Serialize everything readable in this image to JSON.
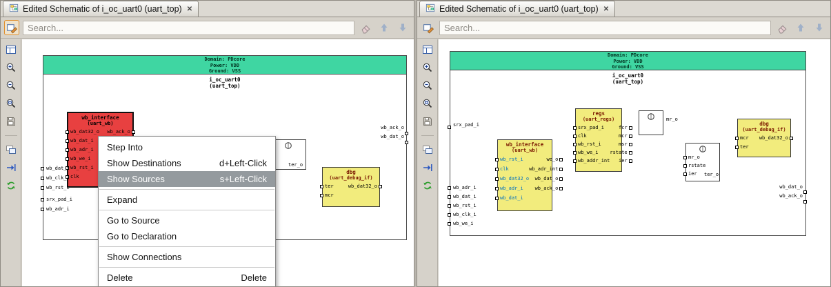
{
  "colors": {
    "domain_band": "#3fd6a2",
    "selected_block": "#e84040",
    "module_block": "#f2ec7d",
    "menu_highlight": "#949a9e",
    "blue_port": "#0070c0"
  },
  "sidebar_icons": [
    "view-grid",
    "zoom-in",
    "zoom-out",
    "zoom-fit",
    "save",
    "new-window",
    "trace-arrows",
    "reload"
  ],
  "panels": [
    {
      "tab": {
        "title": "Edited Schematic of i_oc_uart0 (uart_top)",
        "close_glyph": "✕"
      },
      "toolbar": {
        "search_placeholder": "Search..."
      },
      "schematic": {
        "domain_lines": [
          "Domain: PDcore",
          "Power: VDD",
          "Ground: VSS"
        ],
        "instance_name": "i_oc_uart0",
        "instance_type": "(uart_top)",
        "edge_pins_left": [
          "wb_dat_i",
          "wb_clk_i",
          "wb_rst_i"
        ],
        "edge_pins_left2": [
          "srx_pad_i",
          "wb_adr_i"
        ],
        "edge_labels_right": [
          "wb_ack_o",
          "wb_dat_o"
        ],
        "blocks": {
          "wb": {
            "title": "wb_interface",
            "subtitle": "(uart_wb)",
            "ports_left": [
              "wb_dat32_o",
              "wb_dat_i",
              "wb_adr_i",
              "wb_we_i",
              "wb_rst_i",
              "clk"
            ],
            "ports_right": [
              "wb_ack_o"
            ]
          },
          "gate": {
            "label": "ter_o"
          },
          "dbg": {
            "title": "dbg",
            "subtitle": "(uart_debug_if)",
            "ports_left": [
              "ter",
              "mcr"
            ],
            "ports_right": [
              "wb_dat32_o"
            ]
          }
        }
      },
      "context_menu": {
        "items": [
          {
            "label": "Step Into",
            "shortcut": ""
          },
          {
            "label": "Show Destinations",
            "shortcut": "d+Left-Click"
          },
          {
            "label": "Show Sources",
            "shortcut": "s+Left-Click"
          },
          {
            "label": "Expand",
            "shortcut": ""
          },
          {
            "label": "Go to Source",
            "shortcut": ""
          },
          {
            "label": "Go to Declaration",
            "shortcut": ""
          },
          {
            "label": "Show Connections",
            "shortcut": ""
          },
          {
            "label": "Delete",
            "shortcut": "Delete"
          }
        ]
      }
    },
    {
      "tab": {
        "title": "Edited Schematic of i_oc_uart0 (uart_top)",
        "close_glyph": "✕"
      },
      "toolbar": {
        "search_placeholder": "Search..."
      },
      "schematic": {
        "domain_lines": [
          "Domain: PDcore",
          "Power: VDD",
          "Ground: VSS"
        ],
        "instance_name": "i_oc_uart0",
        "instance_type": "(uart_top)",
        "edge_pin_top": "srx_pad_i",
        "edge_pins_left": [
          "wb_adr_i",
          "wb_dat_i",
          "wb_rst_i",
          "wb_clk_i",
          "wb_we_i"
        ],
        "edge_labels_right": [
          "wb_dat_o",
          "wb_ack_o"
        ],
        "blocks": {
          "wb": {
            "title": "wb_interface",
            "subtitle": "(uart_wb)",
            "ports_left": [
              "wb_rst_i",
              "clk",
              "wb_dat32_o",
              "wb_adr_i",
              "wb_dat_i"
            ],
            "ports_right": [
              "we_o",
              "wb_adr_int",
              "wb_dat_o",
              "wb_ack_o"
            ]
          },
          "regs": {
            "title": "regs",
            "subtitle": "(uart_regs)",
            "ports_left": [
              "srx_pad_i",
              "clk",
              "wb_rst_i",
              "wb_we_i",
              "wb_addr_int"
            ],
            "ports_right": [
              "fcr",
              "mcr",
              "msr",
              "rstate",
              "ier"
            ]
          },
          "gate1": {
            "label": "mr_o"
          },
          "gate2": {
            "ports_left": [
              "mr_o",
              "rstate",
              "ier"
            ],
            "label": "ter_o"
          },
          "dbg": {
            "title": "dbg",
            "subtitle": "(uart_debug_if)",
            "ports_left": [
              "mcr",
              "ter"
            ],
            "ports_right": [
              "wb_dat32_o"
            ]
          }
        }
      }
    }
  ]
}
